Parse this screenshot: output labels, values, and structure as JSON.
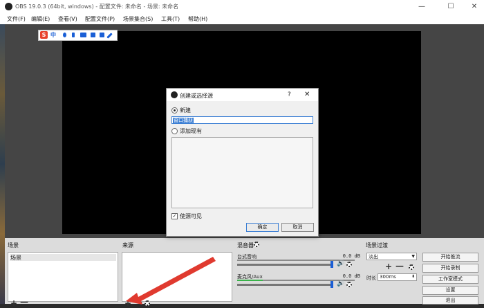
{
  "window": {
    "title": "OBS 19.0.3 (64bit, windows) - 配置文件: 未命名 - 场景: 未命名",
    "minimize": "—",
    "maximize": "☐",
    "close": "✕"
  },
  "menu": [
    "文件(F)",
    "编辑(E)",
    "查看(V)",
    "配置文件(P)",
    "场景集合(S)",
    "工具(T)",
    "帮助(H)"
  ],
  "ime": {
    "logo": "S",
    "mode": "中"
  },
  "docks": {
    "scenes": {
      "title": "场景",
      "items": [
        "场景"
      ],
      "add": "+",
      "remove": "—"
    },
    "sources": {
      "title": "来源",
      "add": "+",
      "remove": "—"
    },
    "mixer": {
      "title": "混音器",
      "channels": [
        {
          "name": "台式音响",
          "db": "0.0 dB",
          "level": 0.0
        },
        {
          "name": "麦克风/Aux",
          "db": "0.0 dB",
          "level": 0.22
        }
      ]
    },
    "transitions": {
      "title": "场景过渡",
      "selected": "淡出",
      "add": "+",
      "remove": "—",
      "duration_label": "时长",
      "duration": "300ms"
    }
  },
  "controls": [
    "开始推流",
    "开始录制",
    "工作室模式",
    "设置",
    "退出"
  ],
  "dialog": {
    "title": "创建或选择源",
    "help": "?",
    "close": "✕",
    "create_new": "新建",
    "name_value": "窗口捕获",
    "add_existing": "添加现有",
    "visible_label": "使源可见",
    "visible_checked": true,
    "ok": "确定",
    "cancel": "取消"
  },
  "colors": {
    "accent": "#3c7fd4",
    "meter": "#39b34a",
    "arrow": "#e03a2f"
  }
}
